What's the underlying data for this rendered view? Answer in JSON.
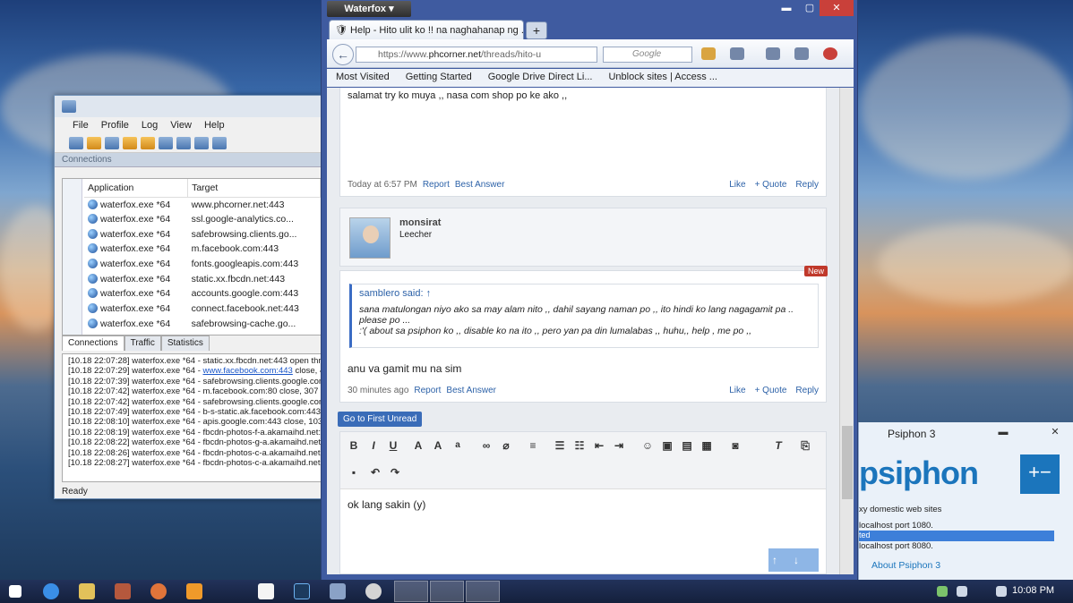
{
  "proxifier": {
    "menu": [
      "File",
      "Profile",
      "Log",
      "View",
      "Help"
    ],
    "section": "Connections",
    "columns": [
      "Application",
      "Target"
    ],
    "rows": [
      [
        "waterfox.exe *64",
        "www.phcorner.net:443"
      ],
      [
        "waterfox.exe *64",
        "ssl.google-analytics.co..."
      ],
      [
        "waterfox.exe *64",
        "safebrowsing.clients.go..."
      ],
      [
        "waterfox.exe *64",
        "m.facebook.com:443"
      ],
      [
        "waterfox.exe *64",
        "fonts.googleapis.com:443"
      ],
      [
        "waterfox.exe *64",
        "static.xx.fbcdn.net:443"
      ],
      [
        "waterfox.exe *64",
        "accounts.google.com:443"
      ],
      [
        "waterfox.exe *64",
        "connect.facebook.net:443"
      ],
      [
        "waterfox.exe *64",
        "safebrowsing-cache.go..."
      ]
    ],
    "tabs": [
      "Connections",
      "Traffic",
      "Statistics"
    ],
    "log": [
      "[10.18 22:07:28] waterfox.exe *64 - static.xx.fbcdn.net:443 open thro",
      "[10.18 22:07:29] waterfox.exe *64 - ",
      "[10.18 22:07:39] waterfox.exe *64 - safebrowsing.clients.google.com",
      "[10.18 22:07:42] waterfox.exe *64 - m.facebook.com:80 close, 307 b",
      "[10.18 22:07:42] waterfox.exe *64 - safebrowsing.clients.google.com",
      "[10.18 22:07:49] waterfox.exe *64 - b-s-static.ak.facebook.com:443",
      "[10.18 22:08:10] waterfox.exe *64 - apis.google.com:443 close, 1034",
      "[10.18 22:08:19] waterfox.exe *64 - fbcdn-photos-f-a.akamaihd.net:4",
      "[10.18 22:08:22] waterfox.exe *64 - fbcdn-photos-g-a.akamaihd.net:4",
      "[10.18 22:08:26] waterfox.exe *64 - fbcdn-photos-c-a.akamaihd.net:4",
      "[10.18 22:08:27] waterfox.exe *64 - fbcdn-photos-c-a.akamaihd.net:4"
    ],
    "log_link": "www.facebook.com:443",
    "log_link_tail": " close, 4",
    "status": "Ready"
  },
  "browser": {
    "app_button": "Waterfox ▾",
    "tab_title": "Help - Hito ulit ko !! na naghahanap ng ...",
    "url_prefix": "https://www.",
    "url_host": "phcorner.net",
    "url_rest": "/threads/hito-u",
    "search_placeholder": "Google",
    "bookmarks": [
      "Most Visited",
      "Getting Started",
      "Google Drive Direct Li...",
      "Unblock sites | Access ..."
    ],
    "post1": {
      "text": "salamat try ko muya ,, nasa com shop po ke ako ,,",
      "time": "Today at 6:57 PM",
      "report": "Report",
      "best": "Best Answer",
      "like": "Like",
      "quote": "+ Quote",
      "reply": "Reply"
    },
    "user": {
      "name": "monsirat",
      "title": "Leecher"
    },
    "post2": {
      "badge": "New",
      "quote_head": "samblero said: ↑",
      "quote_l1": "sana matulongan niyo ako sa may alam nito ,, dahil sayang naman po ,, ito hindi ko lang nagagamit pa ..",
      "quote_l2": "please po ...",
      "quote_l3": ":'( about sa psiphon ko ,, disable ko na ito ,, pero yan pa din lumalabas ,, huhu,, help , me po ,,",
      "body": "anu va gamit mu na sim",
      "time": "30 minutes ago",
      "report": "Report",
      "best": "Best Answer",
      "like": "Like",
      "quote": "+ Quote",
      "reply": "Reply"
    },
    "go_first": "Go to First Unread",
    "editor_text": "ok lang sakin (y)"
  },
  "psiphon": {
    "title": "Psiphon 3",
    "logo": "psiphon",
    "l1": "xy domestic web sites",
    "l2": "localhost port 1080.",
    "l3": "ted",
    "l4": "localhost port 8080.",
    "link": "About Psiphon 3"
  },
  "taskbar": {
    "time": "10:08 PM"
  }
}
